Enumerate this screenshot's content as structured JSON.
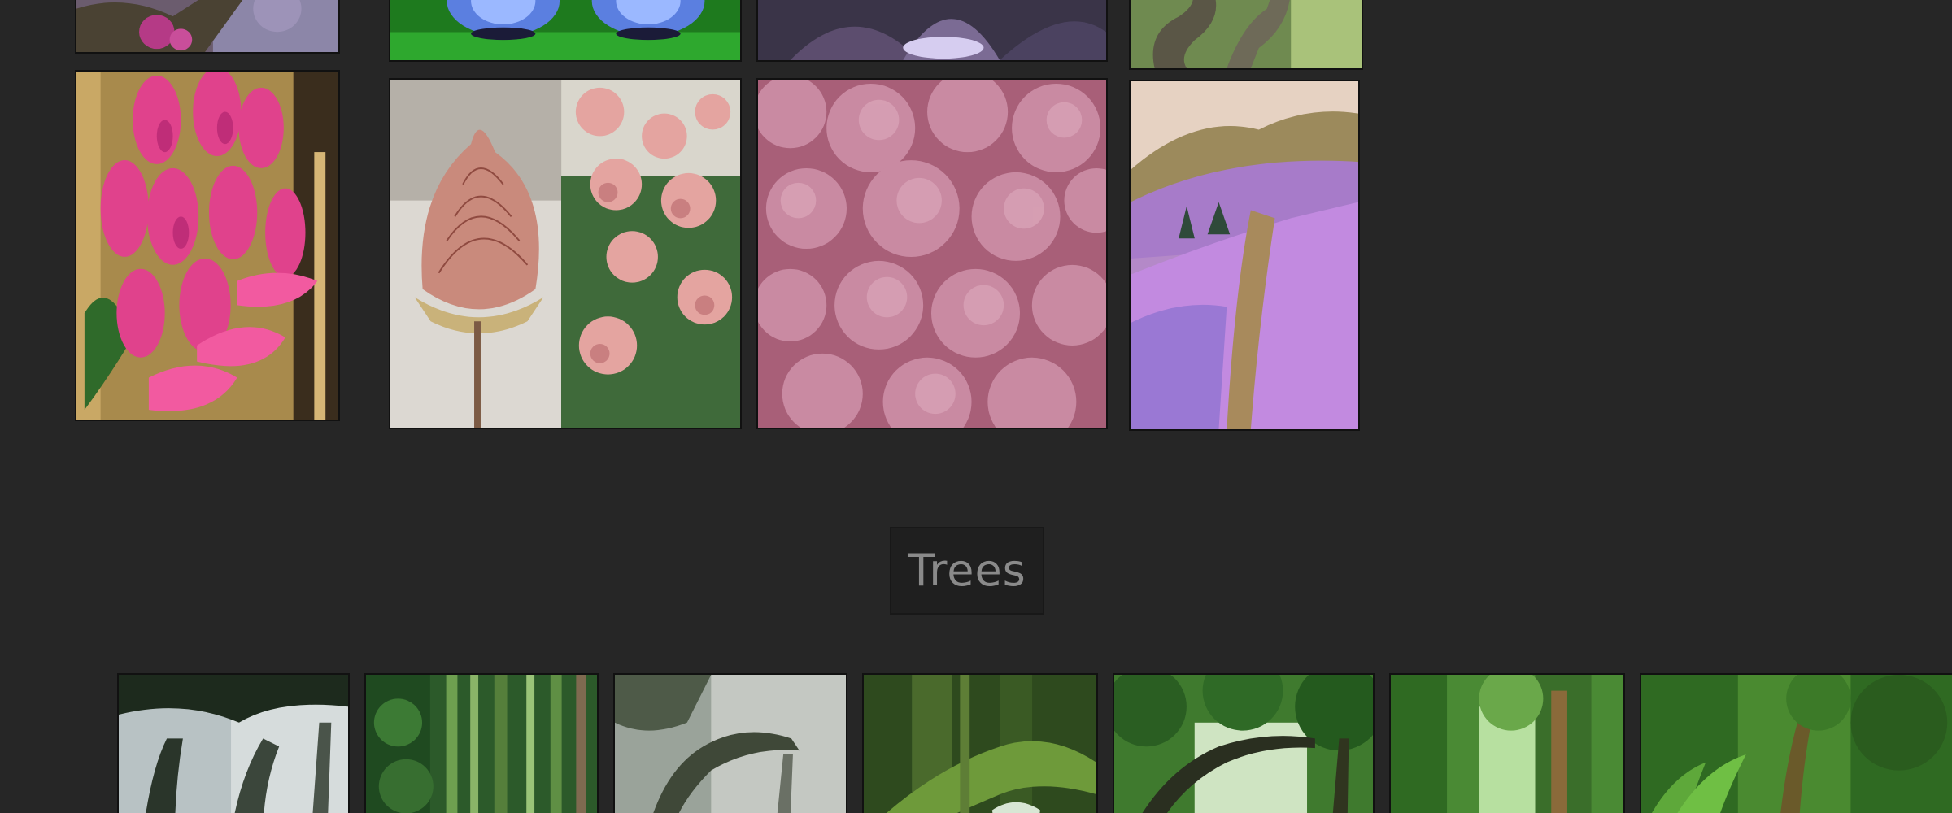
{
  "sections": {
    "trees_title": "Trees"
  },
  "gallery": {
    "top_row": [
      {
        "name": "pink-blossom-tree-photo"
      },
      {
        "name": "blue-glowing-plant-photo"
      },
      {
        "name": "purple-flower-closeup-photo"
      },
      {
        "name": "twisted-trees-photo"
      }
    ],
    "flowers_row": [
      {
        "name": "pink-ginger-flowers-photo"
      },
      {
        "name": "pink-prairie-smoke-photo"
      },
      {
        "name": "pink-lichen-moss-photo"
      },
      {
        "name": "purple-moss-hills-photo"
      }
    ],
    "trees_row": [
      {
        "name": "misty-oak-forest-photo"
      },
      {
        "name": "green-bamboo-forest-photo"
      },
      {
        "name": "foggy-forest-photo"
      },
      {
        "name": "mossy-log-forest-photo"
      },
      {
        "name": "green-canopy-forest-photo"
      },
      {
        "name": "sunlit-jungle-photo"
      },
      {
        "name": "dense-jungle-photo"
      }
    ]
  },
  "colors": {
    "background": "#262626",
    "title_text": "#8a8a8a",
    "title_box": "#1f1f1f"
  }
}
